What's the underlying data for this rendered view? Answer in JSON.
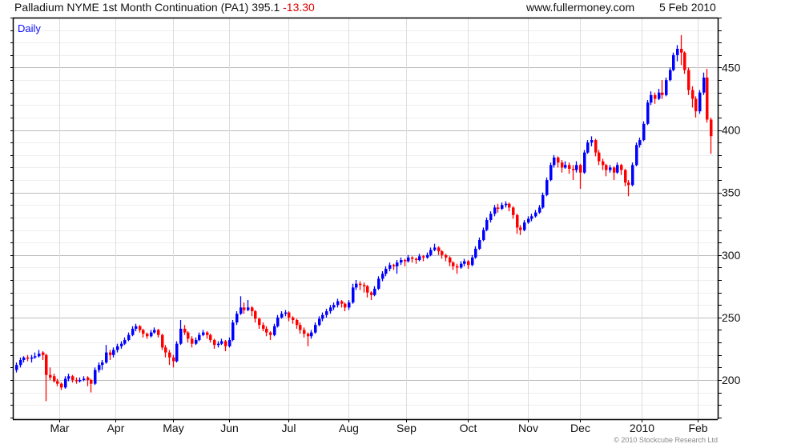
{
  "header": {
    "title": "Palladium NYME 1st Month Continuation (PA1) 395.1",
    "change": "-13.30",
    "site": "www.fullermoney.com",
    "date": "5 Feb 2010"
  },
  "footer": {
    "copyright": "© 2010 Stockcube Research Ltd"
  },
  "colors": {
    "up": "#0000ff",
    "down": "#ff0000",
    "change": "#dd0000",
    "period_label": "#1010ff"
  },
  "chart_data": {
    "type": "candlestick",
    "period_label": "Daily",
    "ylim": [
      168.6,
      490
    ],
    "y_axis_position": "right",
    "y_ticks": [
      200,
      250,
      300,
      350,
      400,
      450
    ],
    "y_minor_step": 10,
    "grid": true,
    "x_ticks": [
      {
        "label": "Mar",
        "at": 11.5
      },
      {
        "label": "Apr",
        "at": 26.5
      },
      {
        "label": "May",
        "at": 42
      },
      {
        "label": "Jun",
        "at": 57
      },
      {
        "label": "Jul",
        "at": 73
      },
      {
        "label": "Aug",
        "at": 89
      },
      {
        "label": "Sep",
        "at": 104.5
      },
      {
        "label": "Oct",
        "at": 121
      },
      {
        "label": "Nov",
        "at": 137
      },
      {
        "label": "Dec",
        "at": 151
      },
      {
        "label": "2010",
        "at": 167.5
      },
      {
        "label": "Feb",
        "at": 182.5
      }
    ],
    "ohlc_fields": [
      "open",
      "high",
      "low",
      "close"
    ],
    "candles": [
      [
        208,
        214,
        206,
        212
      ],
      [
        212,
        218,
        210,
        216
      ],
      [
        216,
        219,
        214,
        218
      ],
      [
        218,
        220,
        215,
        217
      ],
      [
        217,
        220,
        214,
        218
      ],
      [
        218,
        222,
        217,
        219
      ],
      [
        219,
        224,
        218,
        221
      ],
      [
        222,
        223,
        216,
        220
      ],
      [
        220,
        221,
        183,
        204
      ],
      [
        204,
        210,
        200,
        202
      ],
      [
        203,
        205,
        198,
        199
      ],
      [
        199,
        201,
        195,
        197
      ],
      [
        197,
        198,
        192,
        194
      ],
      [
        194,
        203,
        193,
        201
      ],
      [
        201,
        205,
        199,
        203
      ],
      [
        203,
        204,
        198,
        200
      ],
      [
        200,
        202,
        197,
        199
      ],
      [
        199,
        202,
        198,
        200
      ],
      [
        200,
        203,
        199,
        201
      ],
      [
        202,
        203,
        195,
        200
      ],
      [
        200,
        201,
        190,
        197
      ],
      [
        197,
        210,
        196,
        208
      ],
      [
        208,
        214,
        206,
        212
      ],
      [
        212,
        216,
        208,
        214
      ],
      [
        214,
        228,
        213,
        222
      ],
      [
        222,
        224,
        216,
        220
      ],
      [
        220,
        226,
        218,
        224
      ],
      [
        224,
        229,
        222,
        227
      ],
      [
        227,
        231,
        225,
        229
      ],
      [
        229,
        234,
        228,
        232
      ],
      [
        232,
        238,
        231,
        236
      ],
      [
        236,
        243,
        235,
        241
      ],
      [
        241,
        245,
        239,
        243
      ],
      [
        243,
        244,
        238,
        240
      ],
      [
        240,
        241,
        234,
        237
      ],
      [
        237,
        238,
        233,
        235
      ],
      [
        235,
        240,
        234,
        238
      ],
      [
        238,
        242,
        237,
        240
      ],
      [
        240,
        241,
        234,
        236
      ],
      [
        236,
        237,
        224,
        226
      ],
      [
        226,
        228,
        218,
        222
      ],
      [
        222,
        224,
        212,
        218
      ],
      [
        218,
        220,
        210,
        215
      ],
      [
        215,
        231,
        214,
        229
      ],
      [
        229,
        248,
        228,
        241
      ],
      [
        241,
        244,
        236,
        238
      ],
      [
        238,
        239,
        230,
        233
      ],
      [
        233,
        235,
        226,
        229
      ],
      [
        229,
        234,
        228,
        232
      ],
      [
        232,
        238,
        231,
        236
      ],
      [
        236,
        240,
        235,
        238
      ],
      [
        238,
        239,
        233,
        236
      ],
      [
        236,
        237,
        230,
        232
      ],
      [
        232,
        233,
        225,
        228
      ],
      [
        228,
        231,
        226,
        229
      ],
      [
        229,
        233,
        228,
        231
      ],
      [
        231,
        232,
        223,
        227
      ],
      [
        227,
        234,
        226,
        232
      ],
      [
        232,
        248,
        231,
        246
      ],
      [
        246,
        255,
        244,
        253
      ],
      [
        253,
        267,
        252,
        258
      ],
      [
        258,
        262,
        253,
        256
      ],
      [
        256,
        264,
        255,
        258
      ],
      [
        258,
        259,
        251,
        255
      ],
      [
        255,
        256,
        246,
        249
      ],
      [
        249,
        250,
        241,
        244
      ],
      [
        244,
        246,
        239,
        241
      ],
      [
        241,
        243,
        235,
        238
      ],
      [
        238,
        239,
        232,
        236
      ],
      [
        236,
        245,
        235,
        243
      ],
      [
        243,
        252,
        242,
        250
      ],
      [
        250,
        255,
        249,
        253
      ],
      [
        253,
        256,
        251,
        254
      ],
      [
        254,
        255,
        247,
        250
      ],
      [
        250,
        251,
        245,
        248
      ],
      [
        248,
        249,
        241,
        244
      ],
      [
        244,
        246,
        237,
        240
      ],
      [
        240,
        242,
        234,
        237
      ],
      [
        237,
        238,
        227,
        235
      ],
      [
        235,
        240,
        233,
        238
      ],
      [
        238,
        246,
        237,
        244
      ],
      [
        244,
        251,
        243,
        249
      ],
      [
        249,
        254,
        247,
        252
      ],
      [
        252,
        257,
        250,
        255
      ],
      [
        255,
        260,
        253,
        258
      ],
      [
        258,
        262,
        256,
        260
      ],
      [
        260,
        265,
        258,
        263
      ],
      [
        263,
        264,
        258,
        261
      ],
      [
        261,
        262,
        255,
        258
      ],
      [
        258,
        264,
        256,
        262
      ],
      [
        262,
        277,
        261,
        274
      ],
      [
        274,
        280,
        272,
        277
      ],
      [
        277,
        279,
        272,
        276
      ],
      [
        276,
        278,
        270,
        275
      ],
      [
        275,
        276,
        266,
        270
      ],
      [
        270,
        271,
        264,
        268
      ],
      [
        268,
        275,
        267,
        273
      ],
      [
        273,
        283,
        272,
        281
      ],
      [
        281,
        287,
        279,
        285
      ],
      [
        285,
        291,
        283,
        289
      ],
      [
        289,
        294,
        287,
        292
      ],
      [
        292,
        293,
        288,
        291
      ],
      [
        291,
        296,
        285,
        294
      ],
      [
        294,
        298,
        292,
        296
      ],
      [
        296,
        297,
        291,
        295
      ],
      [
        295,
        300,
        294,
        298
      ],
      [
        298,
        299,
        294,
        297
      ],
      [
        297,
        298,
        293,
        296
      ],
      [
        296,
        301,
        295,
        299
      ],
      [
        299,
        300,
        295,
        298
      ],
      [
        298,
        302,
        297,
        300
      ],
      [
        300,
        306,
        299,
        304
      ],
      [
        304,
        309,
        303,
        306
      ],
      [
        306,
        307,
        300,
        303
      ],
      [
        303,
        304,
        297,
        300
      ],
      [
        300,
        301,
        295,
        298
      ],
      [
        298,
        299,
        291,
        294
      ],
      [
        294,
        295,
        288,
        291
      ],
      [
        291,
        293,
        285,
        290
      ],
      [
        290,
        295,
        289,
        293
      ],
      [
        293,
        297,
        291,
        295
      ],
      [
        295,
        296,
        289,
        292
      ],
      [
        292,
        300,
        291,
        298
      ],
      [
        298,
        307,
        297,
        305
      ],
      [
        305,
        314,
        304,
        312
      ],
      [
        312,
        322,
        311,
        320
      ],
      [
        320,
        330,
        319,
        328
      ],
      [
        328,
        335,
        326,
        333
      ],
      [
        333,
        340,
        331,
        338
      ],
      [
        338,
        341,
        334,
        337
      ],
      [
        337,
        342,
        336,
        340
      ],
      [
        340,
        343,
        338,
        341
      ],
      [
        341,
        342,
        335,
        338
      ],
      [
        338,
        339,
        329,
        332
      ],
      [
        332,
        333,
        317,
        322
      ],
      [
        322,
        324,
        316,
        320
      ],
      [
        320,
        328,
        319,
        326
      ],
      [
        326,
        331,
        325,
        329
      ],
      [
        329,
        333,
        327,
        331
      ],
      [
        331,
        336,
        330,
        334
      ],
      [
        334,
        340,
        333,
        338
      ],
      [
        338,
        350,
        337,
        348
      ],
      [
        348,
        362,
        347,
        360
      ],
      [
        360,
        374,
        359,
        372
      ],
      [
        372,
        380,
        370,
        378
      ],
      [
        378,
        379,
        370,
        374
      ],
      [
        374,
        376,
        366,
        370
      ],
      [
        370,
        375,
        369,
        372
      ],
      [
        372,
        374,
        365,
        369
      ],
      [
        369,
        372,
        360,
        368
      ],
      [
        368,
        375,
        366,
        372
      ],
      [
        372,
        373,
        353,
        366
      ],
      [
        366,
        384,
        365,
        382
      ],
      [
        382,
        392,
        381,
        390
      ],
      [
        390,
        395,
        387,
        392
      ],
      [
        392,
        393,
        379,
        382
      ],
      [
        382,
        384,
        372,
        375
      ],
      [
        375,
        377,
        368,
        372
      ],
      [
        372,
        373,
        363,
        368
      ],
      [
        368,
        372,
        366,
        370
      ],
      [
        370,
        371,
        360,
        366
      ],
      [
        366,
        374,
        365,
        372
      ],
      [
        372,
        373,
        364,
        368
      ],
      [
        368,
        369,
        355,
        358
      ],
      [
        358,
        360,
        347,
        356
      ],
      [
        356,
        374,
        355,
        372
      ],
      [
        372,
        390,
        371,
        388
      ],
      [
        388,
        394,
        386,
        392
      ],
      [
        392,
        407,
        391,
        405
      ],
      [
        405,
        424,
        404,
        422
      ],
      [
        422,
        431,
        420,
        428
      ],
      [
        428,
        430,
        421,
        425
      ],
      [
        425,
        433,
        424,
        430
      ],
      [
        430,
        440,
        425,
        428
      ],
      [
        428,
        442,
        427,
        440
      ],
      [
        440,
        450,
        439,
        448
      ],
      [
        448,
        462,
        447,
        460
      ],
      [
        460,
        468,
        455,
        465
      ],
      [
        465,
        476,
        452,
        462
      ],
      [
        462,
        463,
        445,
        448
      ],
      [
        448,
        450,
        428,
        432
      ],
      [
        432,
        435,
        418,
        425
      ],
      [
        425,
        427,
        410,
        415
      ],
      [
        415,
        432,
        413,
        430
      ],
      [
        430,
        446,
        428,
        442
      ],
      [
        442,
        449,
        406,
        408.4
      ],
      [
        408.4,
        410,
        381,
        395.1
      ]
    ]
  }
}
